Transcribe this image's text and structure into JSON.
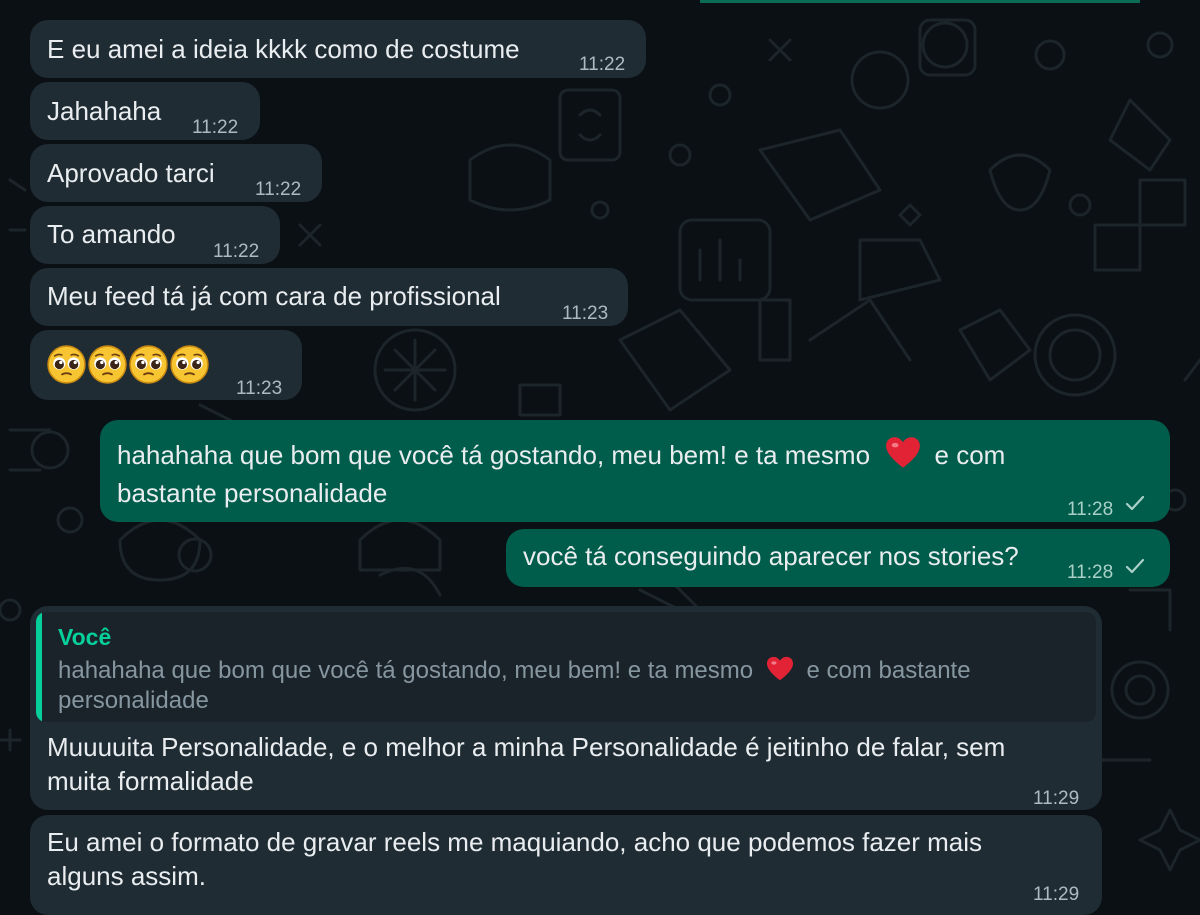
{
  "theme": {
    "background": "#0b1014",
    "incoming_bubble": "#1f2c34",
    "outgoing_bubble": "#005c4b",
    "quote_accent": "#06cf9c",
    "text": "#e9edef"
  },
  "messages": [
    {
      "id": "m1",
      "direction": "in",
      "text": "E eu amei a ideia kkkk como de costume",
      "time": "11:22"
    },
    {
      "id": "m2",
      "direction": "in",
      "text": "Jahahaha",
      "time": "11:22"
    },
    {
      "id": "m3",
      "direction": "in",
      "text": "Aprovado tarci",
      "time": "11:22"
    },
    {
      "id": "m4",
      "direction": "in",
      "text": "To amando",
      "time": "11:22"
    },
    {
      "id": "m5",
      "direction": "in",
      "text": "Meu feed tá já com cara de profissional",
      "time": "11:23"
    },
    {
      "id": "m6",
      "direction": "in",
      "emojis": [
        "pleading-face",
        "pleading-face",
        "pleading-face",
        "pleading-face"
      ],
      "time": "11:23"
    },
    {
      "id": "m7",
      "direction": "out",
      "text_before_heart": "hahahaha que bom que você tá gostando, meu bem! e ta mesmo",
      "text_after_heart": "e com",
      "text_line2": "bastante personalidade",
      "time": "11:28",
      "status": "sent-check-icon"
    },
    {
      "id": "m8",
      "direction": "out",
      "text": "você tá conseguindo aparecer nos stories?",
      "time": "11:28",
      "status": "sent-check-icon"
    },
    {
      "id": "m9",
      "direction": "in",
      "quote": {
        "author": "Você",
        "text_before_heart": "hahahaha que bom que você tá gostando, meu bem! e ta mesmo",
        "text_after_heart": "e com bastante",
        "text_line2": "personalidade"
      },
      "text_line1": "Muuuuita Personalidade, e o melhor a minha Personalidade é jeitinho de falar, sem",
      "text_line2": "muita formalidade",
      "time": "11:29"
    },
    {
      "id": "m10",
      "direction": "in",
      "text_line1": "Eu amei o formato de gravar reels me maquiando, acho que podemos fazer mais",
      "text_line2": "alguns assim.",
      "time": "11:29"
    }
  ]
}
